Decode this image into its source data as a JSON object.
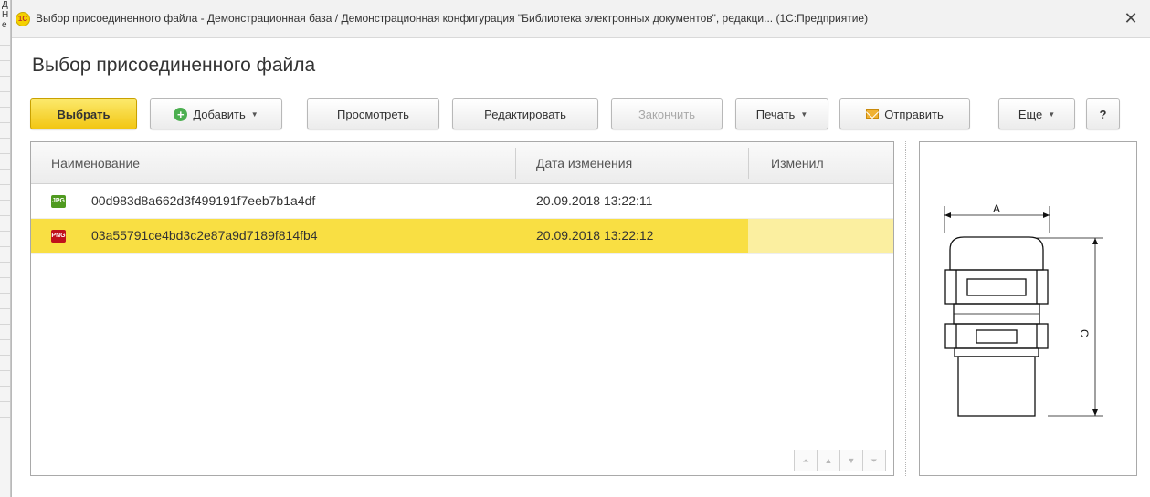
{
  "window": {
    "logo": "1С",
    "title": "Выбор присоединенного файла - Демонстрационная база / Демонстрационная конфигурация \"Библиотека электронных документов\", редакци... (1С:Предприятие)",
    "close_icon": "close-icon"
  },
  "background": {
    "text": [
      "Д",
      "Н",
      "е"
    ]
  },
  "page": {
    "title": "Выбор присоединенного файла"
  },
  "toolbar": {
    "select": "Выбрать",
    "add": "Добавить",
    "view": "Просмотреть",
    "edit": "Редактировать",
    "finish": "Закончить",
    "print": "Печать",
    "send": "Отправить",
    "more": "Еще",
    "help": "?"
  },
  "grid": {
    "columns": [
      "Наименование",
      "Дата изменения",
      "Изменил"
    ],
    "rows": [
      {
        "type_icon": "JPG",
        "name": "00d983d8a662d3f499191f7eeb7b1a4df",
        "date": "20.09.2018 13:22:11",
        "changed_by": "",
        "selected": false
      },
      {
        "type_icon": "PNG",
        "name": "03a55791ce4bd3c2e87a9d7189f814fb4",
        "date": "20.09.2018 13:22:12",
        "changed_by": "",
        "selected": true
      }
    ],
    "nav_icons": [
      "first-page-icon",
      "prev-page-icon",
      "next-page-icon",
      "last-page-icon"
    ]
  },
  "preview": {
    "label_a": "A",
    "label_c": "C"
  },
  "colors": {
    "selected_row": "#f9df43",
    "primary_button": "#f2c613",
    "add_icon": "#4caf50"
  }
}
